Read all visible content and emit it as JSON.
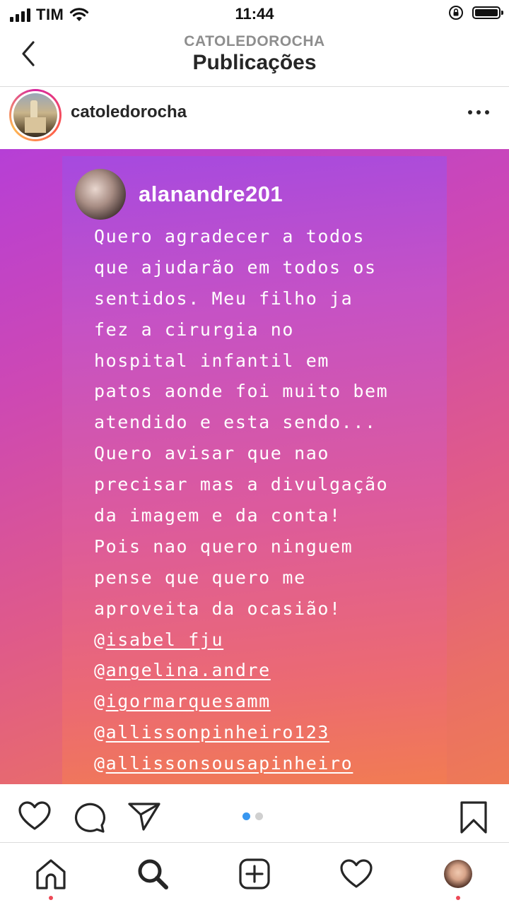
{
  "status_bar": {
    "carrier": "TIM",
    "time": "11:44",
    "icons": [
      "signal-icon",
      "wifi-icon",
      "rotation-lock-icon",
      "battery-icon"
    ]
  },
  "header": {
    "subtitle": "CATOLEDOROCHA",
    "title": "Publicações",
    "back_icon": "chevron-left-icon"
  },
  "post": {
    "username": "catoledorocha",
    "more_icon": "more-horizontal-icon",
    "story": {
      "username": "alanandre201",
      "lines": [
        "Quero agradecer a todos",
        "que ajudarão em todos os",
        "sentidos. Meu filho ja",
        "fez a cirurgia no",
        "hospital infantil em",
        "patos aonde foi muito bem",
        "atendido e esta sendo...",
        "Quero avisar que nao",
        "precisar mas a divulgação",
        "da imagem e da conta!",
        "Pois nao quero ninguem",
        "pense que quero me",
        "aproveita da ocasião!"
      ],
      "mentions": [
        {
          "at": "@",
          "handle": "isabel_fju"
        },
        {
          "at": "@",
          "handle": "angelina.andre"
        },
        {
          "at": "@",
          "handle": "igormarquesamm"
        },
        {
          "at": "@",
          "handle": "allissonpinheiro123"
        },
        {
          "at": "@",
          "handle": "allissonsousapinheiro"
        }
      ]
    },
    "carousel": {
      "count": 2,
      "active_index": 0,
      "active_color": "#3897f0",
      "inactive_color": "#d0d0d0"
    }
  },
  "actions": [
    "heart-icon",
    "comment-icon",
    "share-icon",
    "bookmark-icon"
  ],
  "tab_bar": {
    "tabs": [
      "home-icon",
      "search-icon",
      "new-post-icon",
      "activity-icon",
      "profile-avatar"
    ],
    "notification_color": "#ed4956"
  }
}
